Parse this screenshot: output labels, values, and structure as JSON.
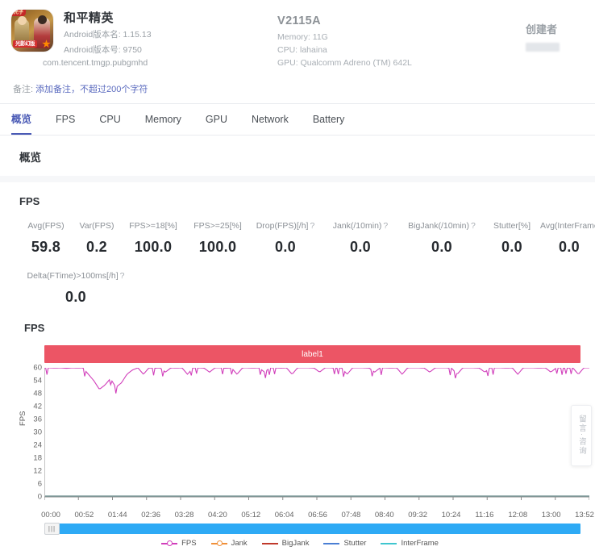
{
  "app": {
    "icon_name": "app-icon-peacekeeper-elite",
    "title": "和平精英",
    "version_name_label": "Android版本名: 1.15.13",
    "version_code_label": "Android版本号: 9750",
    "package": "com.tencent.tmgp.pubgmhd"
  },
  "device": {
    "model": "V2115A",
    "memory": "Memory: 11G",
    "cpu": "CPU: lahaina",
    "gpu": "GPU: Qualcomm Adreno (TM) 642L"
  },
  "creator": {
    "title": "创建者",
    "value": ""
  },
  "remark": {
    "label": "备注:",
    "link": "添加备注，不超过200个字符"
  },
  "tabs": [
    {
      "label": "概览",
      "active": true
    },
    {
      "label": "FPS",
      "active": false
    },
    {
      "label": "CPU",
      "active": false
    },
    {
      "label": "Memory",
      "active": false
    },
    {
      "label": "GPU",
      "active": false
    },
    {
      "label": "Network",
      "active": false
    },
    {
      "label": "Battery",
      "active": false
    }
  ],
  "overview": {
    "card_title": "概览",
    "section_title": "FPS"
  },
  "metrics_row1": [
    {
      "label": "Avg(FPS)",
      "help": false,
      "value": "59.8"
    },
    {
      "label": "Var(FPS)",
      "help": false,
      "value": "0.2"
    },
    {
      "label": "FPS>=18[%]",
      "help": false,
      "value": "100.0"
    },
    {
      "label": "FPS>=25[%]",
      "help": false,
      "value": "100.0"
    },
    {
      "label": "Drop(FPS)[/h]",
      "help": true,
      "value": "0.0"
    },
    {
      "label": "Jank(/10min)",
      "help": true,
      "value": "0.0"
    },
    {
      "label": "BigJank(/10min)",
      "help": true,
      "value": "0.0"
    },
    {
      "label": "Stutter[%]",
      "help": false,
      "value": "0.0"
    },
    {
      "label": "Avg(InterFrame)",
      "help": false,
      "value": "0.0"
    }
  ],
  "metrics_row2": [
    {
      "label": "Delta(FTime)>100ms[/h]",
      "help": true,
      "value": "0.0"
    }
  ],
  "chart_block": {
    "title": "FPS",
    "label_bar_text": "label1",
    "label_bar_color": "#ec5565",
    "scrollbar_color": "#2eaaf5",
    "scroll_handle_glyph": "|||"
  },
  "side_widget": {
    "text": "留言·咨询"
  },
  "chart_data": {
    "type": "line",
    "title": "FPS",
    "xlabel": "",
    "ylabel": "FPS",
    "ylim": [
      0,
      60
    ],
    "yticks": [
      0,
      6,
      12,
      18,
      24,
      30,
      36,
      42,
      48,
      54,
      60
    ],
    "grid": false,
    "legend_position": "bottom",
    "x_ticks": [
      "00:00",
      "00:52",
      "01:44",
      "02:36",
      "03:28",
      "04:20",
      "05:12",
      "06:04",
      "06:56",
      "07:48",
      "08:40",
      "09:32",
      "10:24",
      "11:16",
      "12:08",
      "13:00",
      "13:52"
    ],
    "x_range_seconds": [
      0,
      832
    ],
    "series": [
      {
        "name": "FPS",
        "color": "#d13fbb",
        "note": "Flat near 59-60 FPS across the whole run with frequent shallow 1-3 fps dips and one deeper cluster dropping to ~50 around 00:20-00:40",
        "values": [
          60,
          60,
          59.9,
          60,
          59.8,
          60,
          59.9,
          60,
          57,
          54,
          50,
          52,
          55,
          51,
          53,
          57,
          59,
          60,
          57,
          60,
          59.8,
          60,
          58,
          60,
          59.9,
          60,
          57,
          60,
          60,
          59.9,
          58,
          60,
          60,
          59.8,
          60,
          57,
          60,
          60,
          59.9,
          60,
          58,
          60,
          60,
          59.9,
          60,
          57,
          60,
          60,
          60,
          59.9,
          58,
          60,
          60,
          59.8,
          60,
          57,
          60,
          60,
          60,
          59.9,
          58,
          60,
          60,
          59.9,
          60,
          57,
          60,
          60,
          60,
          59.9,
          58,
          60,
          60,
          60,
          59.8,
          57,
          60,
          60,
          60,
          59.9,
          58,
          60,
          60,
          60,
          59.9,
          60,
          57,
          60,
          60,
          60,
          59.9,
          60,
          58,
          60,
          60,
          59.9,
          60,
          57,
          60,
          60
        ]
      },
      {
        "name": "Jank",
        "color": "#f0903a",
        "values": []
      },
      {
        "name": "BigJank",
        "color": "#c0392b",
        "values": []
      },
      {
        "name": "Stutter",
        "color": "#4a7fd4",
        "values": []
      },
      {
        "name": "InterFrame",
        "color": "#3fc6cf",
        "values": []
      }
    ],
    "baseline_series_color": "#7d9a9a",
    "legend": [
      {
        "label": "FPS",
        "color": "#d13fbb",
        "marker": true
      },
      {
        "label": "Jank",
        "color": "#f0903a",
        "marker": true
      },
      {
        "label": "BigJank",
        "color": "#c0392b",
        "marker": false
      },
      {
        "label": "Stutter",
        "color": "#4a7fd4",
        "marker": false
      },
      {
        "label": "InterFrame",
        "color": "#3fc6cf",
        "marker": false
      }
    ]
  }
}
